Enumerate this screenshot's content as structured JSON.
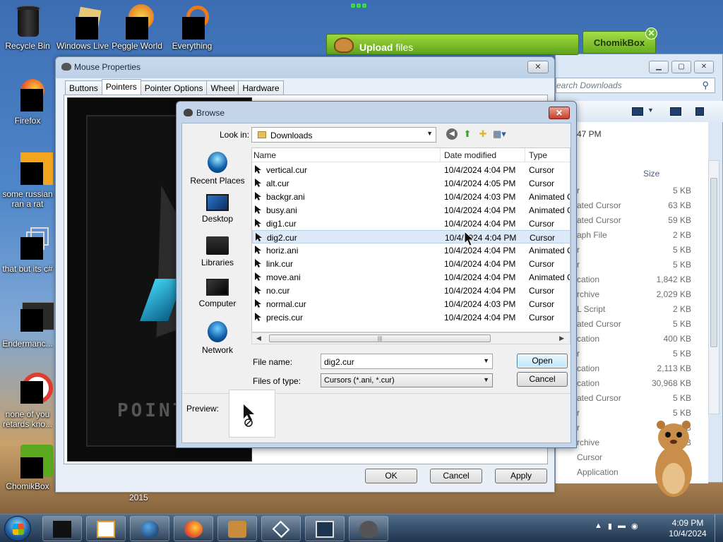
{
  "desktop": {
    "icons": [
      {
        "label": "Recycle Bin"
      },
      {
        "label": "Windows Live"
      },
      {
        "label": "Peggle World"
      },
      {
        "label": "Everything"
      },
      {
        "label": "Firefox"
      },
      {
        "label": "some russian ran a rat"
      },
      {
        "label": "that but its c#"
      },
      {
        "label": "Endermanc..."
      },
      {
        "label": "none of you retards kno..."
      },
      {
        "label": "ChomikBox"
      }
    ],
    "year_label": "2015"
  },
  "upload_widget": {
    "label_bold": "Upload",
    "label_rest": "files"
  },
  "chomikbox_tab": {
    "label": "ChomikBox",
    "close": "✕"
  },
  "explorer": {
    "search_placeholder": "earch Downloads",
    "time_fragment": "47 PM",
    "size_header": "Size",
    "rows": [
      {
        "type": "r",
        "size": "5 KB"
      },
      {
        "type": "ated Cursor",
        "size": "63 KB"
      },
      {
        "type": "ated Cursor",
        "size": "59 KB"
      },
      {
        "type": "aph File",
        "size": "2 KB"
      },
      {
        "type": "r",
        "size": "5 KB"
      },
      {
        "type": "r",
        "size": "5 KB"
      },
      {
        "type": "cation",
        "size": "1,842 KB"
      },
      {
        "type": "rchive",
        "size": "2,029 KB"
      },
      {
        "type": "L Script",
        "size": "2 KB"
      },
      {
        "type": "ated Cursor",
        "size": "5 KB"
      },
      {
        "type": "cation",
        "size": "400 KB"
      },
      {
        "type": "r",
        "size": "5 KB"
      },
      {
        "type": "cation",
        "size": "2,113 KB"
      },
      {
        "type": "cation",
        "size": "30,968 KB"
      },
      {
        "type": "ated Cursor",
        "size": "5 KB"
      },
      {
        "type": "r",
        "size": "5 KB"
      },
      {
        "type": "r",
        "size": "5 KB"
      },
      {
        "type": "rchive",
        "size": "KB"
      },
      {
        "type": "Cursor",
        "size": ""
      },
      {
        "type": "Application",
        "size": ""
      }
    ]
  },
  "mouse_properties": {
    "title": "Mouse Properties",
    "tabs": [
      "Buttons",
      "Pointers",
      "Pointer Options",
      "Wheel",
      "Hardware"
    ],
    "active_tab": "Pointers",
    "scheme_preview_text": "POINTE",
    "buttons": {
      "ok": "OK",
      "cancel": "Cancel",
      "apply": "Apply"
    }
  },
  "browse": {
    "title": "Browse",
    "close": "✕",
    "look_in_label": "Look in:",
    "look_in_value": "Downloads",
    "places": [
      "Recent Places",
      "Desktop",
      "Libraries",
      "Computer",
      "Network"
    ],
    "columns": {
      "name": "Name",
      "date": "Date modified",
      "type": "Type"
    },
    "files": [
      {
        "name": "vertical.cur",
        "date": "10/4/2024 4:04 PM",
        "type": "Cursor"
      },
      {
        "name": "alt.cur",
        "date": "10/4/2024 4:05 PM",
        "type": "Cursor"
      },
      {
        "name": "backgr.ani",
        "date": "10/4/2024 4:03 PM",
        "type": "Animated C"
      },
      {
        "name": "busy.ani",
        "date": "10/4/2024 4:04 PM",
        "type": "Animated C"
      },
      {
        "name": "dig1.cur",
        "date": "10/4/2024 4:04 PM",
        "type": "Cursor"
      },
      {
        "name": "dig2.cur",
        "date": "10/4/2024 4:04 PM",
        "type": "Cursor"
      },
      {
        "name": "horiz.ani",
        "date": "10/4/2024 4:04 PM",
        "type": "Animated C"
      },
      {
        "name": "link.cur",
        "date": "10/4/2024 4:04 PM",
        "type": "Cursor"
      },
      {
        "name": "move.ani",
        "date": "10/4/2024 4:04 PM",
        "type": "Animated C"
      },
      {
        "name": "no.cur",
        "date": "10/4/2024 4:04 PM",
        "type": "Cursor"
      },
      {
        "name": "normal.cur",
        "date": "10/4/2024 4:03 PM",
        "type": "Cursor"
      },
      {
        "name": "precis.cur",
        "date": "10/4/2024 4:04 PM",
        "type": "Cursor"
      }
    ],
    "selected_file": "dig2.cur",
    "file_name_label": "File name:",
    "file_name_value": "dig2.cur",
    "files_of_type_label": "Files of type:",
    "files_of_type_value": "Cursors (*.ani, *.cur)",
    "open_label": "Open",
    "cancel_label": "Cancel",
    "preview_label": "Preview:",
    "scroll_grip": "|||"
  },
  "taskbar": {
    "clock_time": "4:09 PM",
    "clock_date": "10/4/2024"
  },
  "colors": {
    "accent_green": "#6cbf2a",
    "selection": "#dde9f7",
    "taskbar": "#1c3452"
  }
}
